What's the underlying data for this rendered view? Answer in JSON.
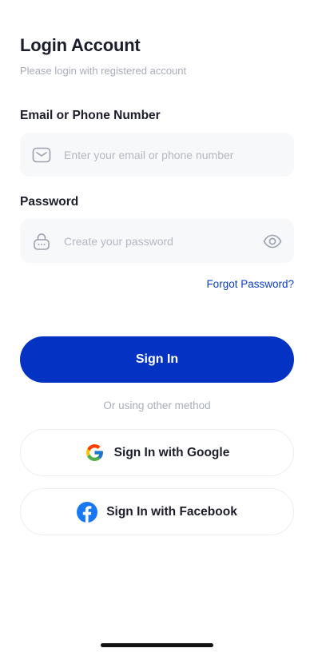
{
  "header": {
    "title": "Login Account",
    "subtitle": "Please login with registered account"
  },
  "form": {
    "email": {
      "label": "Email or Phone Number",
      "placeholder": "Enter your email or phone number",
      "value": "",
      "icon": "mail-icon"
    },
    "password": {
      "label": "Password",
      "placeholder": "Create your password",
      "value": "",
      "icon": "lock-icon",
      "toggle_icon": "eye-icon"
    },
    "forgot_label": "Forgot Password?",
    "submit_label": "Sign In"
  },
  "alt": {
    "divider": "Or using other method",
    "google_label": "Sign In with Google",
    "facebook_label": "Sign In with Facebook"
  },
  "colors": {
    "primary": "#0433c4",
    "link": "#0a3fcb",
    "field_bg": "#f7f8fa",
    "facebook": "#1877f2"
  }
}
